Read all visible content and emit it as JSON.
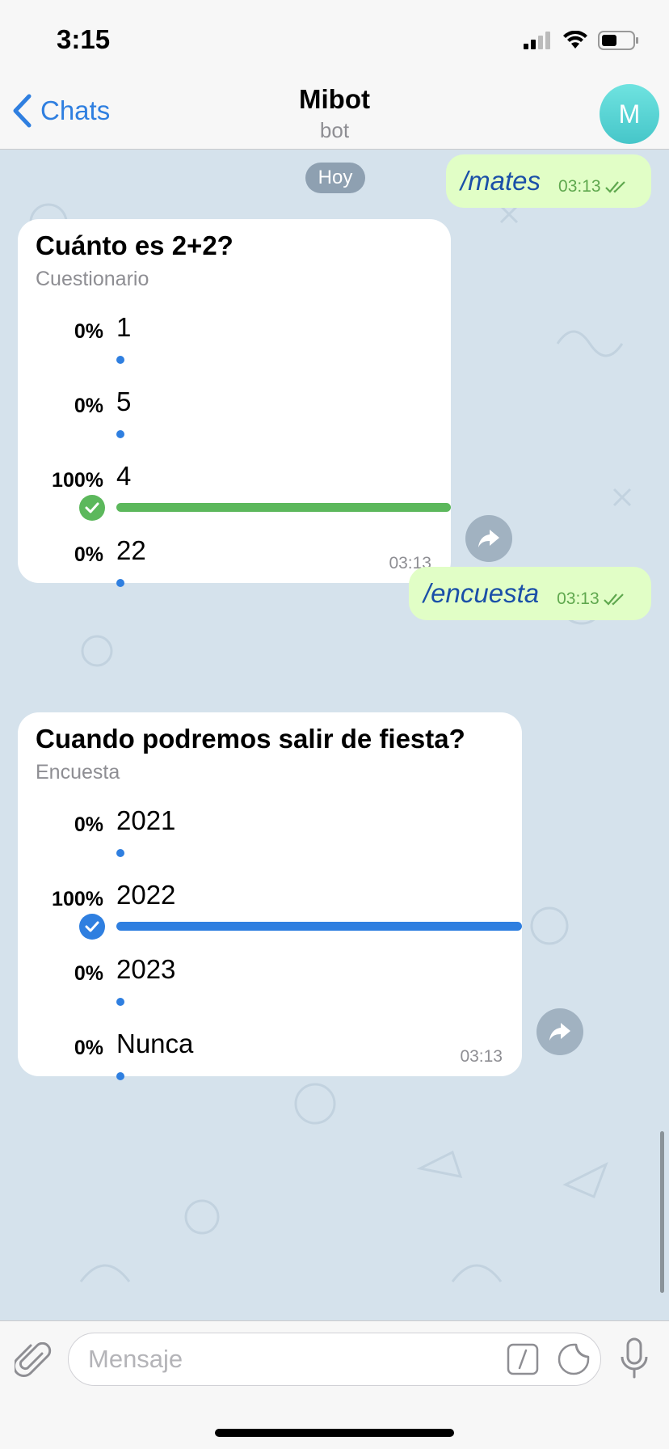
{
  "status_bar": {
    "time": "3:15"
  },
  "header": {
    "back_label": "Chats",
    "title": "Mibot",
    "subtitle": "bot",
    "avatar_letter": "M"
  },
  "chat": {
    "date_label": "Hoy",
    "messages": [
      {
        "text": "/mates",
        "time": "03:13"
      },
      {
        "text": "/encuesta",
        "time": "03:13"
      }
    ],
    "polls": [
      {
        "question": "Cuánto es 2+2?",
        "type": "Cuestionario",
        "time": "03:13",
        "accent": "#5cb85c",
        "options": [
          {
            "percent": "0%",
            "label": "1",
            "fraction": 0
          },
          {
            "percent": "0%",
            "label": "5",
            "fraction": 0
          },
          {
            "percent": "100%",
            "label": "4",
            "fraction": 1,
            "selected": true
          },
          {
            "percent": "0%",
            "label": "22",
            "fraction": 0
          }
        ]
      },
      {
        "question": "Cuando podremos salir de fiesta?",
        "type": "Encuesta",
        "time": "03:13",
        "accent": "#2f7fe0",
        "options": [
          {
            "percent": "0%",
            "label": "2021",
            "fraction": 0
          },
          {
            "percent": "100%",
            "label": "2022",
            "fraction": 1,
            "selected": true
          },
          {
            "percent": "0%",
            "label": "2023",
            "fraction": 0
          },
          {
            "percent": "0%",
            "label": "Nunca",
            "fraction": 0
          }
        ]
      }
    ]
  },
  "input": {
    "placeholder": "Mensaje"
  },
  "colors": {
    "accent": "#2f7fe0",
    "outgoing_bubble": "#e1fec6",
    "quiz_correct": "#5cb85c",
    "chat_background": "#d5e2ec"
  }
}
